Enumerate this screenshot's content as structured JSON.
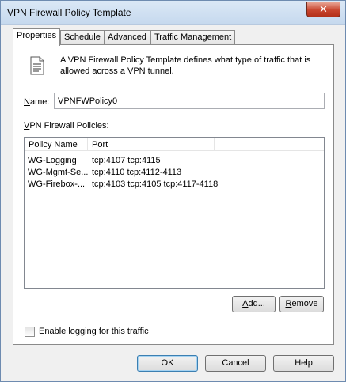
{
  "window": {
    "title": "VPN Firewall Policy Template",
    "close_symbol": "✕"
  },
  "tabs": [
    {
      "label": "Properties",
      "active": true
    },
    {
      "label": "Schedule",
      "active": false
    },
    {
      "label": "Advanced",
      "active": false
    },
    {
      "label": "Traffic Management",
      "active": false
    }
  ],
  "description": "A VPN Firewall Policy Template defines what type of traffic that is allowed across a VPN tunnel.",
  "name_field": {
    "label_key": "N",
    "label_rest": "ame:",
    "value": "VPNFWPolicy0"
  },
  "policies_label": {
    "label_key": "V",
    "label_rest": "PN Firewall Policies:"
  },
  "policies_table": {
    "columns": [
      "Policy Name",
      "Port"
    ],
    "rows": [
      {
        "name": "WG-Logging",
        "port": "tcp:4107 tcp:4115"
      },
      {
        "name": "WG-Mgmt-Se...",
        "port": "tcp:4110 tcp:4112-4113"
      },
      {
        "name": "WG-Firebox-...",
        "port": "tcp:4103 tcp:4105 tcp:4117-4118"
      }
    ]
  },
  "buttons": {
    "add": {
      "key": "A",
      "rest": "dd..."
    },
    "remove": {
      "key": "R",
      "rest": "emove"
    },
    "ok": "OK",
    "cancel": "Cancel",
    "help": "Help"
  },
  "logging": {
    "key": "E",
    "rest": "nable logging for this traffic",
    "checked": false
  }
}
